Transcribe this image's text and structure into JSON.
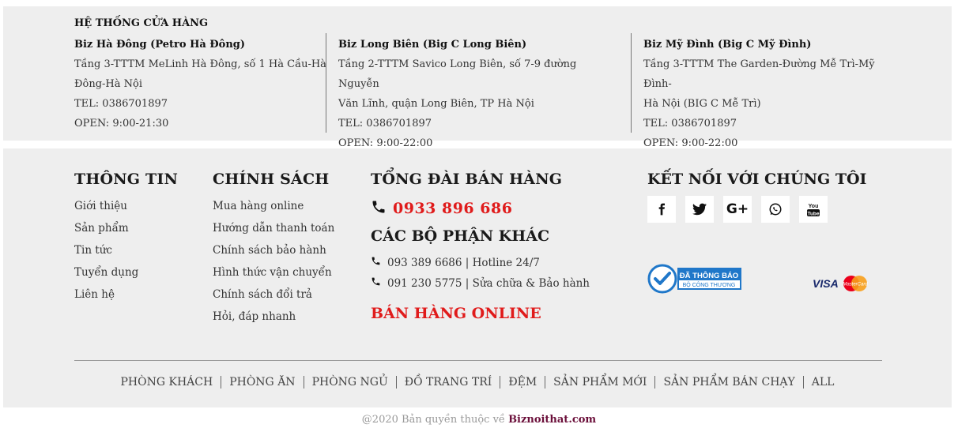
{
  "stores": {
    "title": "HỆ THỐNG CỬA HÀNG",
    "items": [
      {
        "name": "Biz Hà Đông (Petro Hà Đông)",
        "address_line1": "Tầng 3-TTTM MeLinh Hà Đông, số 1 Hà Cầu-Hà",
        "address_line2": "Đông-Hà Nội",
        "tel": "TEL: 0386701897",
        "open": "OPEN: 9:00-21:30"
      },
      {
        "name": "Biz Long Biên (Big C Long Biên)",
        "address_line1": "Tầng 2-TTTM Savico Long Biên, số 7-9 đường Nguyễn",
        "address_line2": "Văn Lĩnh, quận Long Biên, TP Hà Nội",
        "tel": "TEL: 0386701897",
        "open": "OPEN: 9:00-22:00"
      },
      {
        "name": "Biz Mỹ Đình (Big C Mỹ Đình)",
        "address_line1": "Tầng 3-TTTM The Garden-Đường Mễ Trì-Mỹ Đình-",
        "address_line2": "Hà Nội (BIG C Mễ Trì)",
        "tel": "TEL: 0386701897",
        "open": "OPEN: 9:00-22:00"
      }
    ]
  },
  "info": {
    "title": "THÔNG TIN",
    "links": [
      "Giới thiệu",
      "Sản phẩm",
      "Tin tức",
      "Tuyển dụng",
      "Liên hệ"
    ]
  },
  "policy": {
    "title": "CHÍNH SÁCH",
    "links": [
      "Mua hàng online",
      "Hướng dẫn thanh toán",
      "Chính sách bảo hành",
      "Hình thức vận chuyển",
      "Chính sách đổi trả",
      "Hỏi, đáp nhanh"
    ]
  },
  "sales": {
    "title": "TỔNG ĐÀI BÁN HÀNG",
    "hotline": "0933 896 686",
    "other_title": "CÁC BỘ PHẬN KHÁC",
    "dept1": "093 389 6686 | Hotline 24/7",
    "dept2": "091 230 5775 | Sửa chữa & Bảo hành",
    "online_label": "BÁN HÀNG ONLINE"
  },
  "connect": {
    "title": "KẾT NỐI VỚI CHÚNG TÔI",
    "icons": [
      "facebook-icon",
      "twitter-icon",
      "google-plus-icon",
      "whatsapp-icon",
      "youtube-icon"
    ],
    "badge_text": "ĐÃ THÔNG BÁO",
    "badge_sub": "BỘ CÔNG THƯƠNG",
    "visa": "VISA",
    "mastercard": "MasterCard"
  },
  "bottom_menu": [
    "PHÒNG KHÁCH",
    "PHÒNG ĂN",
    "PHÒNG NGỦ",
    "ĐỒ TRANG TRÍ",
    "ĐỆM",
    "SẢN PHẨM MỚI",
    "SẢN PHẨM BÁN CHẠY",
    "ALL"
  ],
  "copyright": {
    "text": "@2020 Bản quyền thuộc về",
    "brand": "Biznoithat.com"
  },
  "colors": {
    "accent_red": "#e01b1b",
    "brand": "#6b0f3a",
    "panel_bg": "#eeeeee"
  }
}
